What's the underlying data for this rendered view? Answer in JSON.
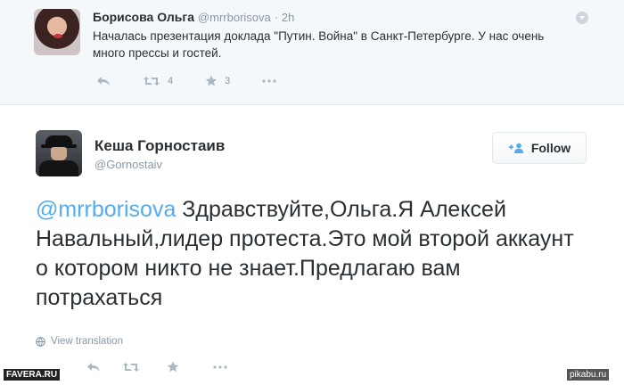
{
  "reply_tweet": {
    "author_name": "Борисова Ольга",
    "handle": "@mrrborisova",
    "separator": "·",
    "time": "2h",
    "text": "Началась презентация доклада \"Путин. Война\" в Санкт-Петербурге. У нас очень много прессы и гостей.",
    "retweet_count": "4",
    "favorite_count": "3",
    "icons": [
      "reply-icon",
      "retweet-icon",
      "favorite-icon",
      "more-icon",
      "caret-icon"
    ]
  },
  "main_tweet": {
    "author_name": "Кеша Горностаив",
    "handle": "@Gornostaiv",
    "follow_label": "Follow",
    "mention": "@mrrborisova",
    "text": " Здравствуйте,Ольга.Я Алексей Навальный,лидер протеста.Это мой второй аккаунт о котором никто не знает.Предлагаю вам потрахаться",
    "translate_label": "View translation",
    "icons": [
      "follow-user-icon",
      "globe-icon",
      "reply-icon",
      "retweet-icon",
      "favorite-icon",
      "more-icon"
    ]
  },
  "watermarks": {
    "left": "FAVERA.RU",
    "right": "pikabu.ru"
  },
  "colors": {
    "link": "#55acee",
    "muted": "#8899a6",
    "icon": "#aab8c2",
    "text": "#292f33",
    "reply_bg": "#f5f8fa"
  }
}
